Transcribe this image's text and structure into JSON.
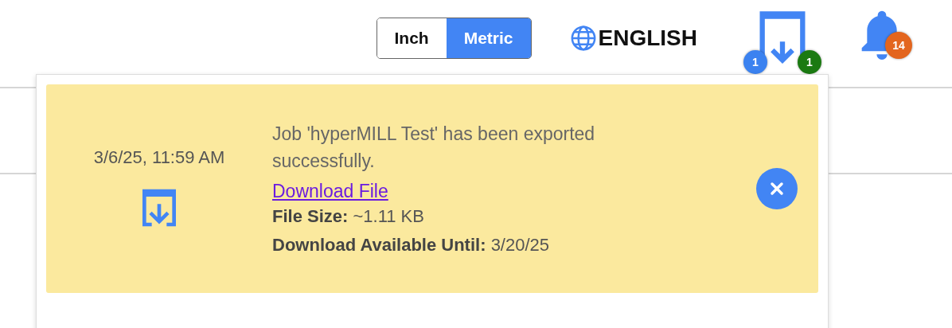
{
  "unit_toggle": [
    {
      "label": "Inch",
      "selected": false
    },
    {
      "label": "Metric",
      "selected": true
    }
  ],
  "language": {
    "label": "ENGLISH"
  },
  "download_badges": [
    {
      "text": "1",
      "color": "#3b82f0"
    },
    {
      "text": "1",
      "color": "#1b7a12"
    }
  ],
  "notifications": {
    "badge": "14"
  },
  "download_panel": {
    "items": [
      {
        "time": "3/6/25, 11:59 AM",
        "message": "Job 'hyperMILL Test' has been exported successfully.",
        "link": "Download File",
        "details": [
          "**File Size:** ~1.11 KB",
          "**Download Available Until:** 3/20/25"
        ]
      }
    ]
  }
}
